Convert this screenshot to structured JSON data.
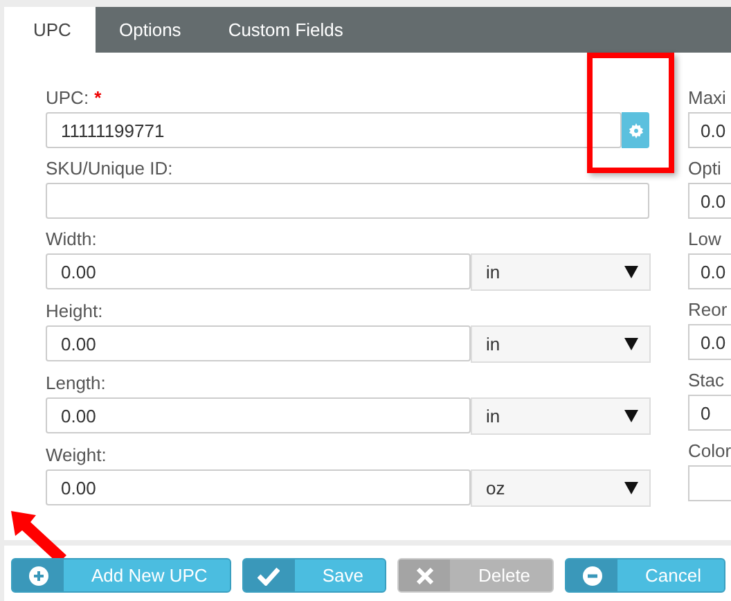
{
  "tabs": [
    {
      "label": "UPC",
      "selected": true
    },
    {
      "label": "Options",
      "selected": false
    },
    {
      "label": "Custom Fields",
      "selected": false
    }
  ],
  "left_fields": [
    {
      "kind": "upc",
      "label": "UPC:",
      "required_mark": "*",
      "value": "11111199771"
    },
    {
      "kind": "text",
      "label": "SKU/Unique ID:"
    },
    {
      "kind": "measure",
      "label": "Width:",
      "value": "0.00",
      "unit": "in"
    },
    {
      "kind": "measure",
      "label": "Height:",
      "value": "0.00",
      "unit": "in"
    },
    {
      "kind": "measure",
      "label": "Length:",
      "value": "0.00",
      "unit": "in"
    },
    {
      "kind": "measure",
      "label": "Weight:",
      "value": "0.00",
      "unit": "oz"
    }
  ],
  "right_fields": [
    {
      "label": "Maxi",
      "value": "0.0"
    },
    {
      "label": "Opti",
      "value": "0.0"
    },
    {
      "label": "Low",
      "value": "0.0"
    },
    {
      "label": "Reor",
      "value": "0.0"
    },
    {
      "label": "Stac",
      "value": "0"
    },
    {
      "label": "Color"
    }
  ],
  "buttons": [
    {
      "kind": "add",
      "label": "Add New UPC",
      "disabled": false
    },
    {
      "kind": "save",
      "label": "Save",
      "disabled": false
    },
    {
      "kind": "delete",
      "label": "Delete",
      "disabled": true
    },
    {
      "kind": "cancel",
      "label": "Cancel",
      "disabled": false
    }
  ]
}
